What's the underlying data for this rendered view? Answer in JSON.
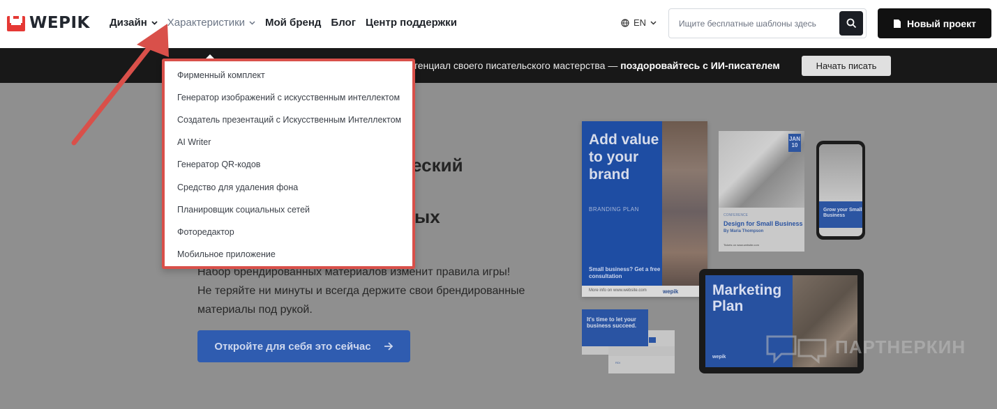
{
  "header": {
    "logo_text": "WEPIK",
    "nav": [
      {
        "label": "Дизайн",
        "has_chevron": true,
        "active": false
      },
      {
        "label": "Характеристики",
        "has_chevron": true,
        "active": true
      },
      {
        "label": "Мой бренд",
        "has_chevron": false,
        "active": false
      },
      {
        "label": "Блог",
        "has_chevron": false,
        "active": false
      },
      {
        "label": "Центр поддержки",
        "has_chevron": false,
        "active": false
      }
    ],
    "language": "EN",
    "search_placeholder": "Ищите бесплатные шаблоны здесь",
    "new_project_label": "Новый проект"
  },
  "banner": {
    "text_prefix": "отенциал своего писательского мастерства — ",
    "text_bold": "поздоровайтесь с ИИ-писателем",
    "button_label": "Начать писать"
  },
  "dropdown": {
    "items": [
      "Фирменный комплект",
      "Генератор изображений с искусственным интеллектом",
      "Создатель презентаций с Искусственным Интеллектом",
      "AI Writer",
      "Генератор QR-кодов",
      "Средство для удаления фона",
      "Планировщик социальных сетей",
      "Фоторедактор",
      "Мобильное приложение"
    ]
  },
  "hero": {
    "title_fragment_1": "еский",
    "title_fragment_2": "ых",
    "description": "Набор брендированных материалов изменит правила игры! Не теряйте ни минуты и всегда держите свои брендированные материалы под рукой.",
    "cta_label": "Откройте для себя это сейчас"
  },
  "mockups": {
    "poster_heading": "Add value to your brand",
    "poster_subtitle": "BRANDING PLAN",
    "poster_footer": "Small business? Get a free consultation",
    "poster_url": "More info on www.website.com",
    "poster_brand": "wepik",
    "flyer_date": "JAN 10",
    "flyer_label": "CONFERENCE",
    "flyer_title": "Design for Small Business",
    "flyer_author": "By Maria Thompson",
    "flyer_url": "Tickets on www.website.com",
    "phone_text": "Grow your Small Business",
    "tablet_title": "Marketing Plan",
    "tablet_brand": "wepik",
    "card_text": "It's time to let your business succeed.",
    "card2_text": "RDI"
  },
  "watermark": "ПАРТНЕРКИН",
  "colors": {
    "logo_red": "#e53935",
    "annotation_red": "#d9504a",
    "primary_blue": "#2f5cb0"
  }
}
